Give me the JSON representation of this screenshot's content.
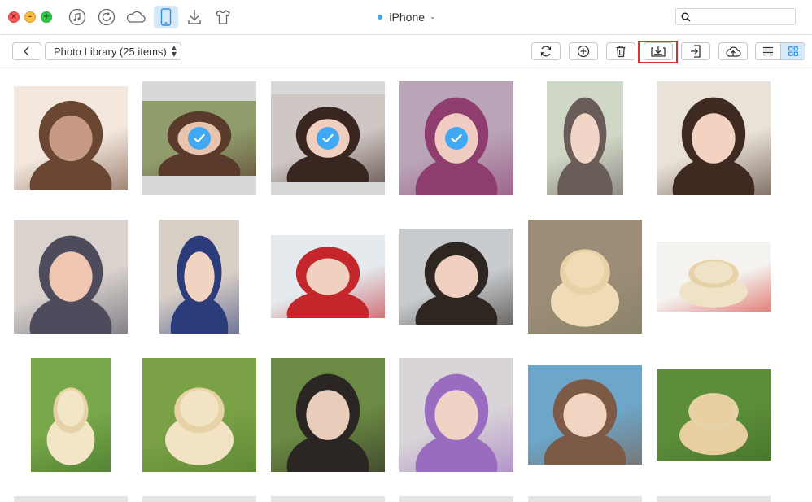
{
  "window": {
    "device_name": "iPhone"
  },
  "nav_icons": [
    {
      "name": "music-icon",
      "active": false
    },
    {
      "name": "backup-history-icon",
      "active": false
    },
    {
      "name": "icloud-icon",
      "active": false
    },
    {
      "name": "iphone-device-icon",
      "active": true
    },
    {
      "name": "download-icon",
      "active": false
    },
    {
      "name": "shirt-icon",
      "active": false
    }
  ],
  "search": {
    "placeholder": "",
    "value": ""
  },
  "toolbar": {
    "library_label": "Photo Library (25 items)"
  },
  "colors": {
    "accent": "#3fa9f5",
    "highlight": "#e0312a",
    "active_bg": "#d5e9fb"
  },
  "photos": [
    {
      "subject": "girl-flower-hat",
      "selected": false
    },
    {
      "subject": "girl-brown-hair",
      "selected": true
    },
    {
      "subject": "girl-bangs-bow",
      "selected": true
    },
    {
      "subject": "girl-flower-crown",
      "selected": true
    },
    {
      "subject": "girl-standing",
      "selected": false
    },
    {
      "subject": "girl-pigtails",
      "selected": false
    },
    {
      "subject": "girl-plaid",
      "selected": false
    },
    {
      "subject": "girl-blonde-flowers",
      "selected": false
    },
    {
      "subject": "girl-lying-down",
      "selected": false
    },
    {
      "subject": "girl-glasses",
      "selected": false
    },
    {
      "subject": "puppy-pinecone",
      "selected": false
    },
    {
      "subject": "puppy-rose",
      "selected": false
    },
    {
      "subject": "puppy-grass",
      "selected": false
    },
    {
      "subject": "puppy-tongue",
      "selected": false
    },
    {
      "subject": "girl-garden",
      "selected": false
    },
    {
      "subject": "girl-purple-dress",
      "selected": false
    },
    {
      "subject": "girl-smiling-bench",
      "selected": false
    },
    {
      "subject": "puppy-playing",
      "selected": false
    }
  ]
}
